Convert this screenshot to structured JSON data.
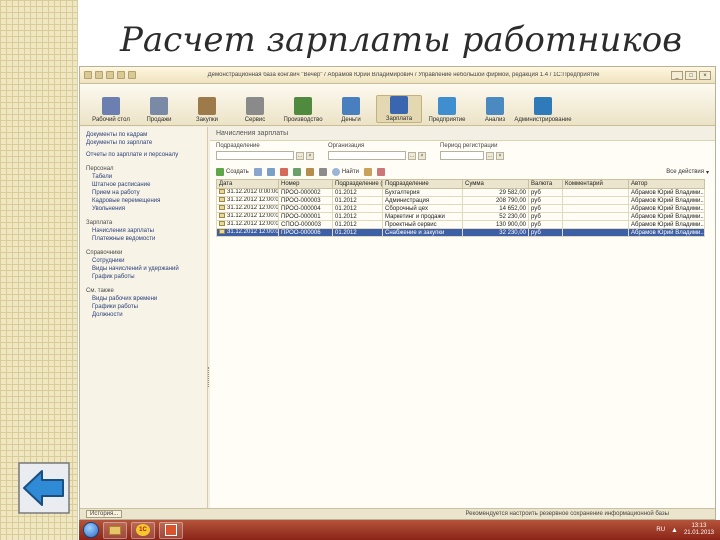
{
  "slide": {
    "title": "Расчет зарплаты работников"
  },
  "window": {
    "title": "Демонстрационная база конг.вич \"Вечер\" / Абрамов Юрий Владимирович / Управление небольшой фирмой, редакция 1.4 / 1С:Предприятие",
    "controls": [
      "_",
      "□",
      "×"
    ]
  },
  "sections": [
    {
      "label": "Рабочий стол",
      "icon": "desktop-icon",
      "color": "#6b7fb0"
    },
    {
      "label": "Продажи",
      "icon": "sales-icon",
      "color": "#7a8aa6"
    },
    {
      "label": "Закупки",
      "icon": "purchases-icon",
      "color": "#9c7a4a"
    },
    {
      "label": "Сервис",
      "icon": "service-icon",
      "color": "#8a8a8a"
    },
    {
      "label": "Производство",
      "icon": "production-icon",
      "color": "#4f8a3e"
    },
    {
      "label": "Деньги",
      "icon": "money-icon",
      "color": "#4a7fbf"
    },
    {
      "label": "Зарплата",
      "icon": "salary-icon",
      "color": "#3a66b0"
    },
    {
      "label": "Предприятие",
      "icon": "enterprise-icon",
      "color": "#3f8fd0"
    },
    {
      "label": "Анализ",
      "icon": "analysis-icon",
      "color": "#4a8ac0"
    },
    {
      "label": "Администрирование",
      "icon": "admin-icon",
      "color": "#2f7ab8"
    }
  ],
  "sidebar": {
    "links": [
      "Документы по кадрам",
      "Документы по зарплате"
    ],
    "report": "Отчеты по зарплате и персоналу",
    "groups": [
      {
        "title": "Персонал",
        "items": [
          "Табели",
          "Штатное расписание",
          "Прием на работу",
          "Кадровые перемещения",
          "Увольнения"
        ]
      },
      {
        "title": "Зарплата",
        "items": [
          "Начисления зарплаты",
          "Платежные ведомости"
        ]
      },
      {
        "title": "Справочники",
        "items": [
          "Сотрудники",
          "Виды начислений и удержаний",
          "График работы"
        ]
      },
      {
        "title": "См. также",
        "items": [
          "Виды рабочих времени",
          "Графики работы",
          "Должности"
        ]
      }
    ]
  },
  "content": {
    "header": "Начисления зарплаты",
    "filters": [
      {
        "label": "Подразделение"
      },
      {
        "label": "Организация"
      },
      {
        "label": "Период регистрации"
      }
    ],
    "toolbar": {
      "create": "Создать",
      "find": "Найти",
      "more": "Все действия"
    },
    "columns": [
      "Дата",
      "Номер",
      "Подразделение",
      "Сумма",
      "Валюта",
      "Комментарий",
      "Автор"
    ],
    "columns_extra": "Подразделение (кадровое)",
    "rows": [
      {
        "date": "31.12.2012 0:00:00",
        "number": "ПРОО-000002",
        "period": "01.2012",
        "dept": "Бухгалтерия",
        "sum": "29 582,00",
        "cur": "руб",
        "comment": "",
        "author": "Абрамов Юрий Владими..."
      },
      {
        "date": "31.12.2012 12:00:00",
        "number": "ПРОО-000003",
        "period": "01.2012",
        "dept": "Администрация",
        "sum": "208 790,00",
        "cur": "руб",
        "comment": "",
        "author": "Абрамов Юрий Владими..."
      },
      {
        "date": "31.12.2012 12:00:00",
        "number": "ПРОО-000004",
        "period": "01.2012",
        "dept": "Сборочный цех",
        "sum": "14 652,00",
        "cur": "руб",
        "comment": "",
        "author": "Абрамов Юрий Владими..."
      },
      {
        "date": "31.12.2012 12:00:00",
        "number": "ПРОО-000001",
        "period": "01.2012",
        "dept": "Маркетинг и продажи",
        "sum": "52 230,00",
        "cur": "руб",
        "comment": "",
        "author": "Абрамов Юрий Владими..."
      },
      {
        "date": "31.12.2012 12:00:00",
        "number": "СПОО-000003",
        "period": "01.2012",
        "dept": "Проектный сервис",
        "sum": "130 900,00",
        "cur": "руб",
        "comment": "",
        "author": "Абрамов Юрий Владими..."
      },
      {
        "date": "31.12.2012 12:00:00",
        "number": "ПРОО-000006",
        "period": "01.2012",
        "dept": "Снабжение и закупки",
        "sum": "32 230,00",
        "cur": "руб",
        "comment": "",
        "author": "Абрамов Юрий Владими..."
      }
    ]
  },
  "statusbar": {
    "history": "История...",
    "note": "Рекомендуется настроить резервное сохранение информационной базы"
  },
  "taskbar": {
    "buttons": [
      "explorer-icon",
      "1С",
      "powerpoint-icon"
    ],
    "lang": "RU",
    "time": "13:13",
    "date": "21.01.2013"
  },
  "colors": {
    "selection": "#3d5fa5",
    "taskbar": "#8a2418",
    "arrow": "#2f8bd6"
  }
}
